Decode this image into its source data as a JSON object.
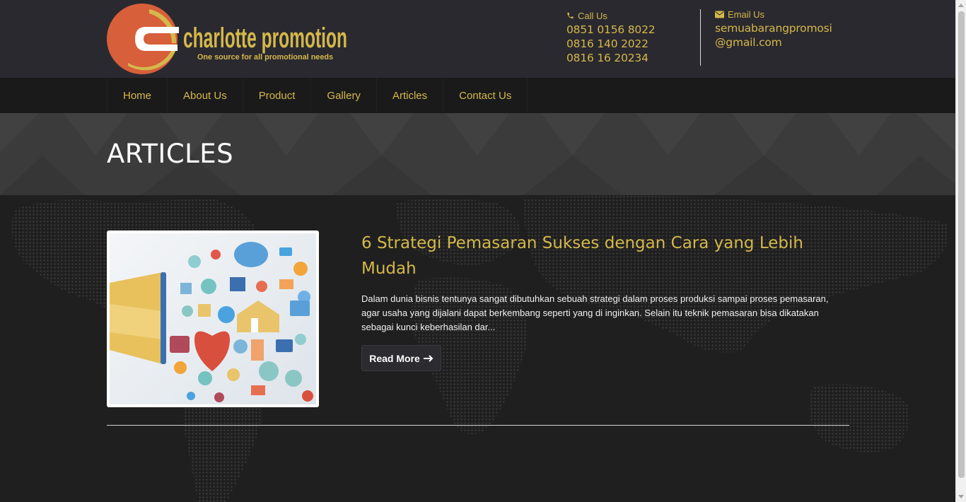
{
  "colors": {
    "accent_gold": "#d4b84b",
    "header_bg": "#2a292f",
    "nav_bg": "#1a1a1b",
    "logo_orange": "#d75f3a"
  },
  "header": {
    "logo": {
      "name": "charlotte promotion",
      "tagline": "One source for all promotional needs"
    },
    "call": {
      "icon": "phone-icon",
      "label": "Call Us",
      "numbers": [
        "0851 0156 8022",
        "0816 140 2022",
        "0816 16 20234"
      ]
    },
    "email": {
      "icon": "envelope-icon",
      "label": "Email Us",
      "address_line1": "semuabarangpromosi",
      "address_line2": "@gmail.com"
    }
  },
  "nav": {
    "items": [
      {
        "label": "Home"
      },
      {
        "label": "About Us"
      },
      {
        "label": "Product"
      },
      {
        "label": "Gallery"
      },
      {
        "label": "Articles"
      },
      {
        "label": "Contact Us"
      }
    ]
  },
  "page": {
    "title": "ARTICLES"
  },
  "articles": [
    {
      "title": "6 Strategi Pemasaran Sukses dengan Cara yang Lebih Mudah",
      "excerpt": "Dalam dunia bisnis tentunya sangat dibutuhkan sebuah strategi dalam proses produksi sampai proses pemasaran, agar usaha yang dijalani dapat berkembang seperti yang di inginkan. Selain itu teknik pemasaran bisa dikatakan sebagai kunci keberhasilan dar...",
      "read_more": "Read More",
      "read_more_icon": "arrow-right-icon",
      "image_icon": "megaphone-social-media-icon"
    }
  ]
}
